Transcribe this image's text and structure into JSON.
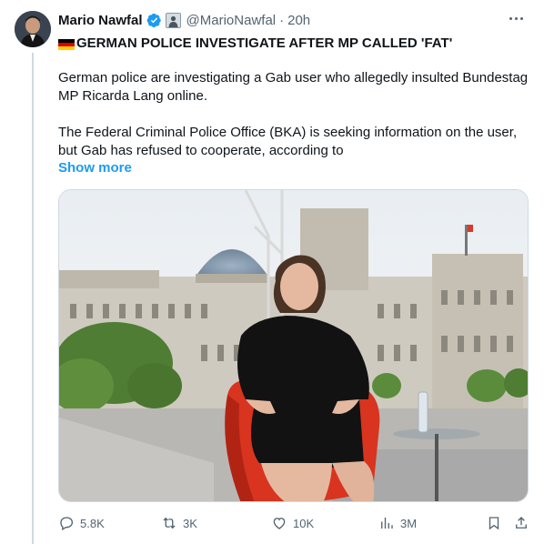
{
  "tweet": {
    "author_name": "Mario Nawfal",
    "handle": "@MarioNawfal",
    "separator": "·",
    "time": "20h",
    "headline": "GERMAN POLICE INVESTIGATE AFTER MP CALLED 'FAT'",
    "paragraph1": "German police are investigating a Gab user who allegedly insulted Bundestag MP Ricarda Lang online.",
    "paragraph2": "The Federal Criminal Police Office (BKA) is seeking information on the user, but Gab has refused to cooperate, according to",
    "show_more": "Show more"
  },
  "icons": {
    "verified": "verified-badge-icon",
    "affiliate": "affiliate-badge-icon",
    "more": "more-options-icon",
    "reply": "reply-icon",
    "repost": "repost-icon",
    "like": "like-icon",
    "views": "views-icon",
    "bookmark": "bookmark-icon",
    "share": "share-icon",
    "flag": "germany-flag-icon"
  },
  "actions": {
    "replies": "5.8K",
    "reposts": "3K",
    "likes": "10K",
    "views": "3M"
  },
  "colors": {
    "accent": "#1d9bf0",
    "text": "#0f1419",
    "muted": "#536471"
  }
}
